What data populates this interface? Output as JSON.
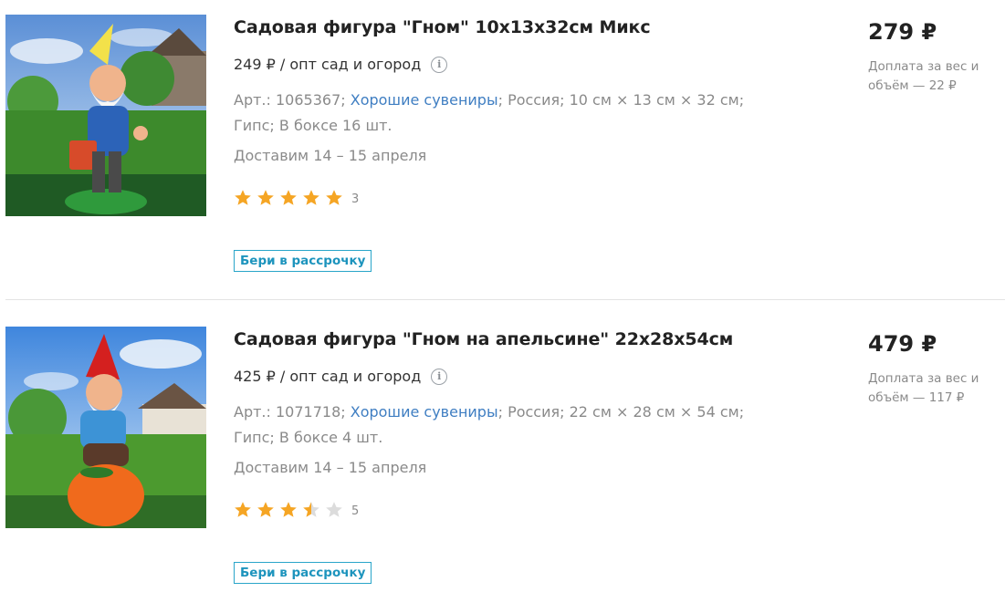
{
  "products": [
    {
      "title": "Садовая фигура \"Гном\" 10х13х32см Микс",
      "wholesale_price": "249 ₽ / опт сад и огород",
      "article": "Арт.: 1065367;",
      "brand": "Хорошие сувениры",
      "details_rest": "; Россия; 10 см × 13 см × 32 см;",
      "details_line2": "Гипс; В боксе 16 шт.",
      "delivery": "Доставим 14 – 15 апреля",
      "rating": 5,
      "rating_count": "3",
      "installment_label": "Бери в рассрочку",
      "price": "279 ₽",
      "surcharge": "Доплата за вес и объём — 22 ₽"
    },
    {
      "title": "Садовая фигура \"Гном на апельсине\" 22х28х54см",
      "wholesale_price": "425 ₽ / опт сад и огород",
      "article": "Арт.: 1071718;",
      "brand": "Хорошие сувениры",
      "details_rest": "; Россия; 22 см × 28 см × 54 см;",
      "details_line2": "Гипс; В боксе 4 шт.",
      "delivery": "Доставим 14 – 15 апреля",
      "rating": 3.5,
      "rating_count": "5",
      "installment_label": "Бери в рассрочку",
      "price": "479 ₽",
      "surcharge": "Доплата за вес и объём — 117 ₽"
    }
  ],
  "colors": {
    "star_filled": "#f5a524",
    "star_empty": "#dcdcdc",
    "link": "#3f7ec2",
    "installment_border": "#29a5c9"
  },
  "icons": {
    "info": "info-circle-icon",
    "star": "star-icon"
  }
}
